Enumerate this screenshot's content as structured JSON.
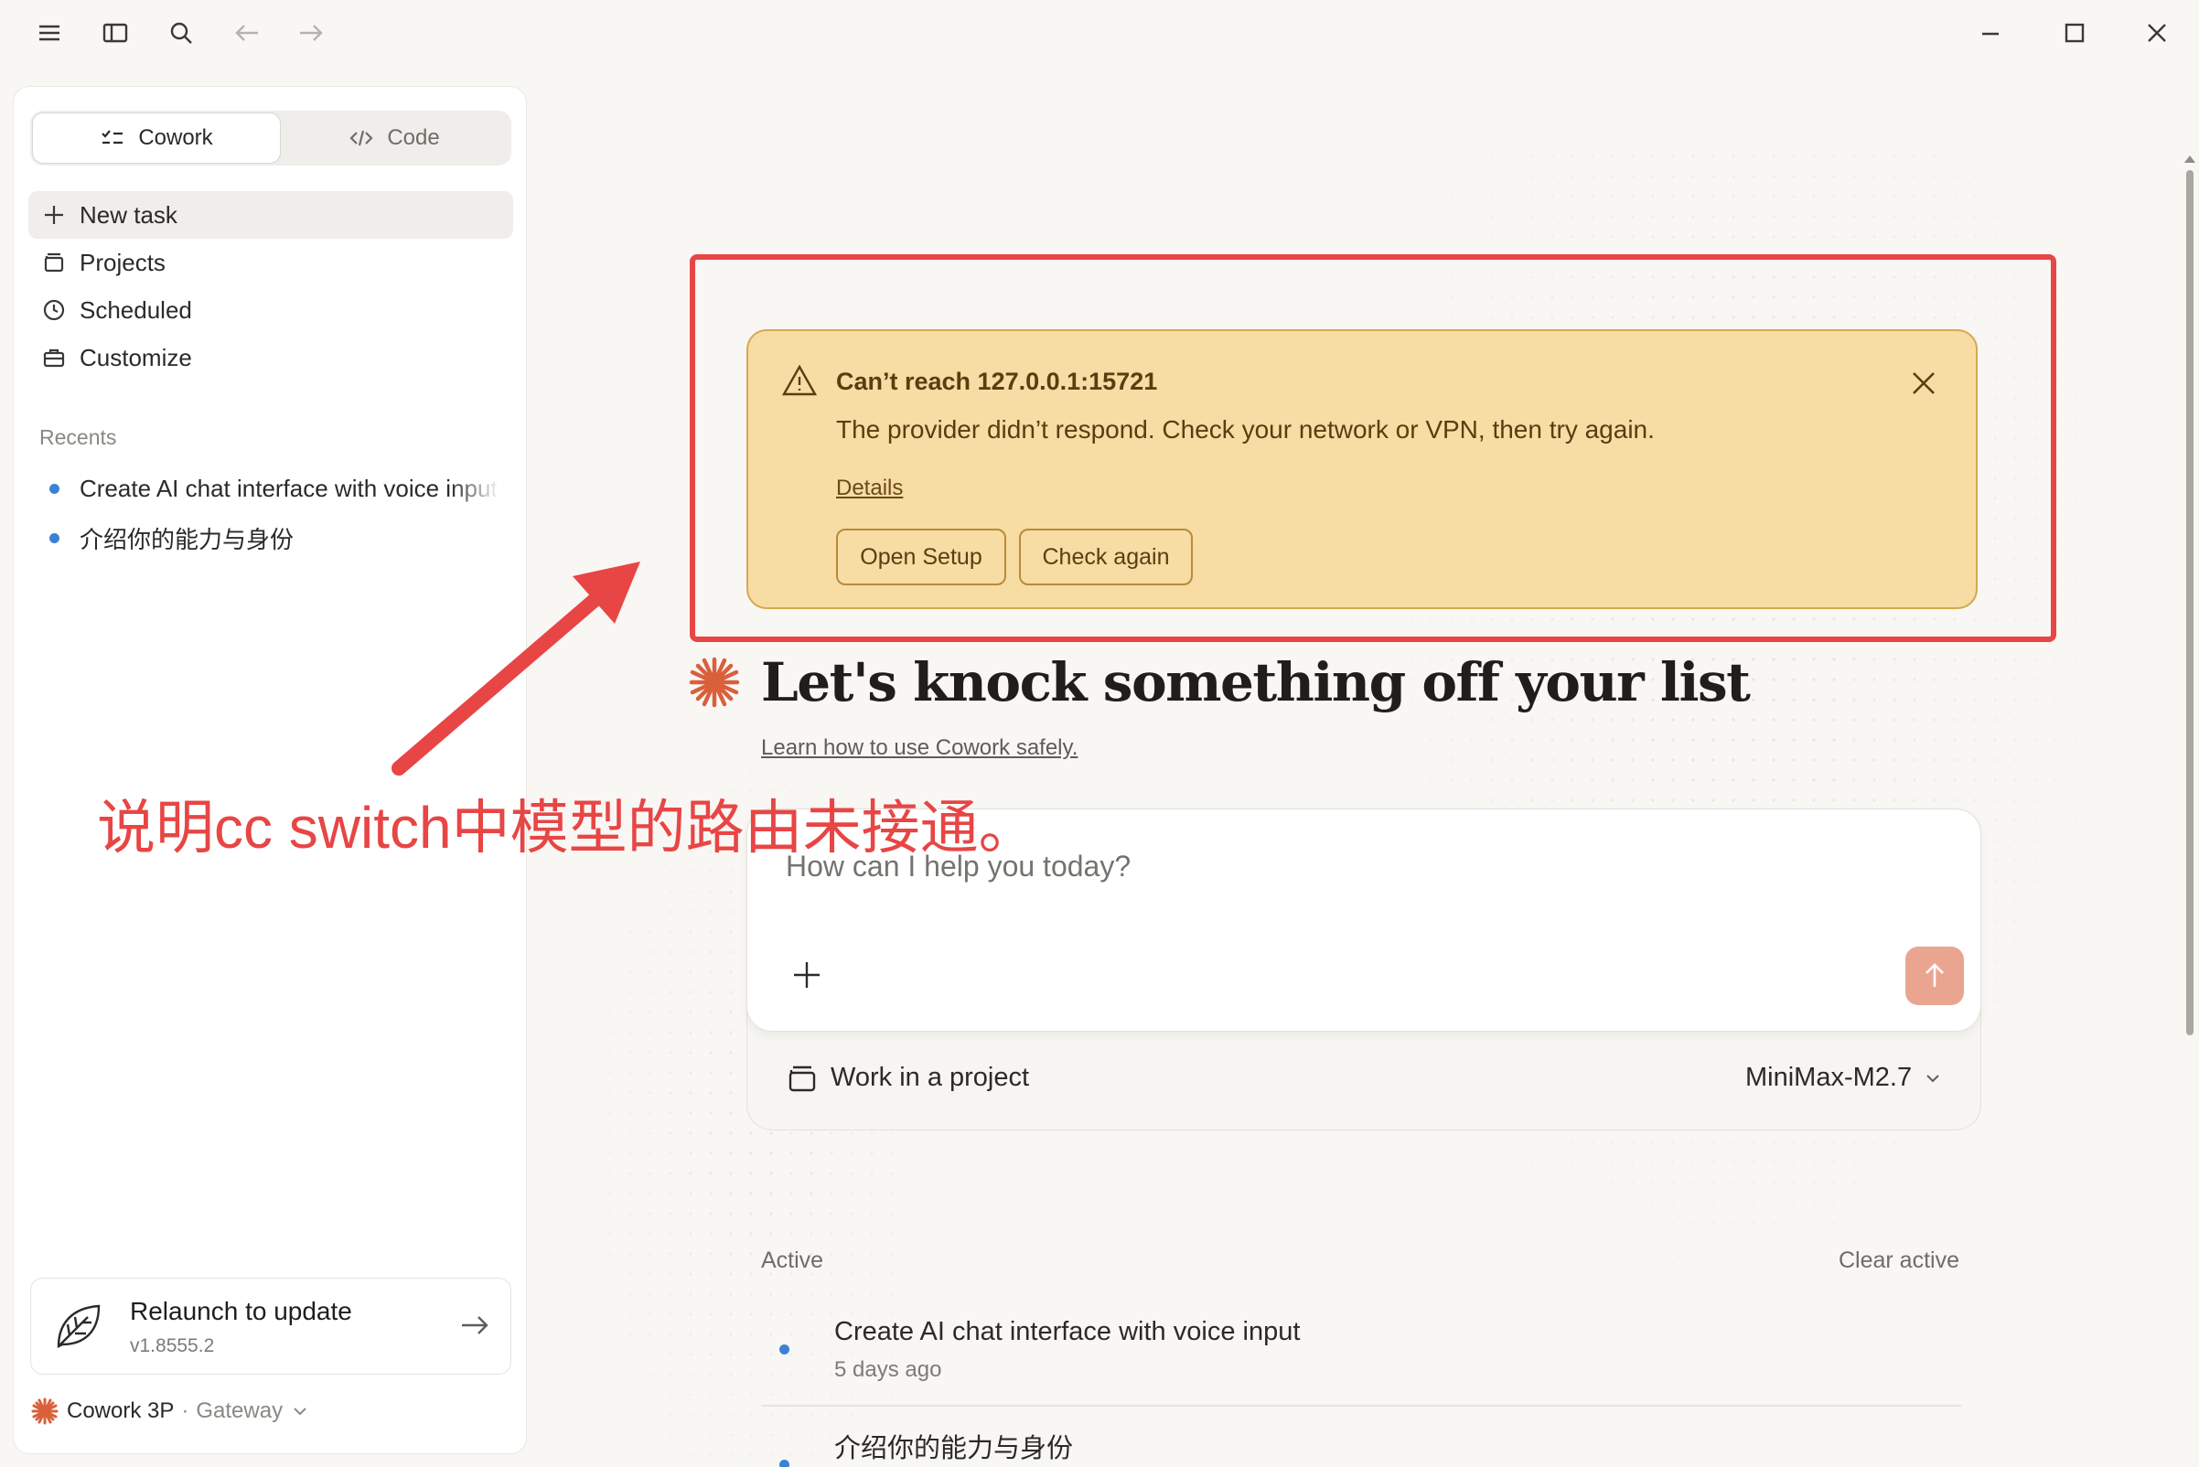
{
  "window": {
    "icons": [
      "menu-icon",
      "sidebar-toggle-icon",
      "search-icon",
      "back-arrow-icon",
      "forward-arrow-icon",
      "minimize-icon",
      "maximize-icon",
      "close-icon"
    ]
  },
  "sidebar": {
    "modes": [
      {
        "label": "Cowork",
        "icon": "checklist-icon",
        "active": true
      },
      {
        "label": "Code",
        "icon": "code-icon",
        "active": false
      }
    ],
    "nav": [
      {
        "label": "New task",
        "icon": "plus-icon",
        "active": true
      },
      {
        "label": "Projects",
        "icon": "box-icon"
      },
      {
        "label": "Scheduled",
        "icon": "clock-icon"
      },
      {
        "label": "Customize",
        "icon": "briefcase-icon"
      }
    ],
    "recents_title": "Recents",
    "recents": [
      "Create AI chat interface with voice input",
      "介绍你的能力与身份"
    ],
    "update": {
      "title": "Relaunch to update",
      "version": "v1.8555.2"
    },
    "account": {
      "name": "Cowork 3P",
      "separator": "·",
      "gateway": "Gateway"
    }
  },
  "alert": {
    "title": "Can’t reach 127.0.0.1:15721",
    "message": "The provider didn’t respond. Check your network or VPN, then try again.",
    "details": "Details",
    "buttons": [
      "Open Setup",
      "Check again"
    ],
    "color_bg": "#f7dca3",
    "color_border": "#d7a84d"
  },
  "annotation": {
    "text": "说明cc switch中模型的路由未接通。",
    "color": "#e84545"
  },
  "main": {
    "headline": "Let's knock something off your list",
    "learn_link": "Learn how to use Cowork safely.",
    "composer": {
      "placeholder": "How can I help you today?",
      "send_color": "#e9a590"
    },
    "project_label": "Work in a project",
    "model": "MiniMax-M2.7",
    "active_label": "Active",
    "clear_label": "Clear active",
    "tasks": [
      {
        "title": "Create AI chat interface with voice input",
        "time": "5 days ago"
      },
      {
        "title": "介绍你的能力与身份",
        "time": ""
      }
    ]
  },
  "colors": {
    "accent": "#d9603b",
    "status_dot": "#3b82d6"
  }
}
